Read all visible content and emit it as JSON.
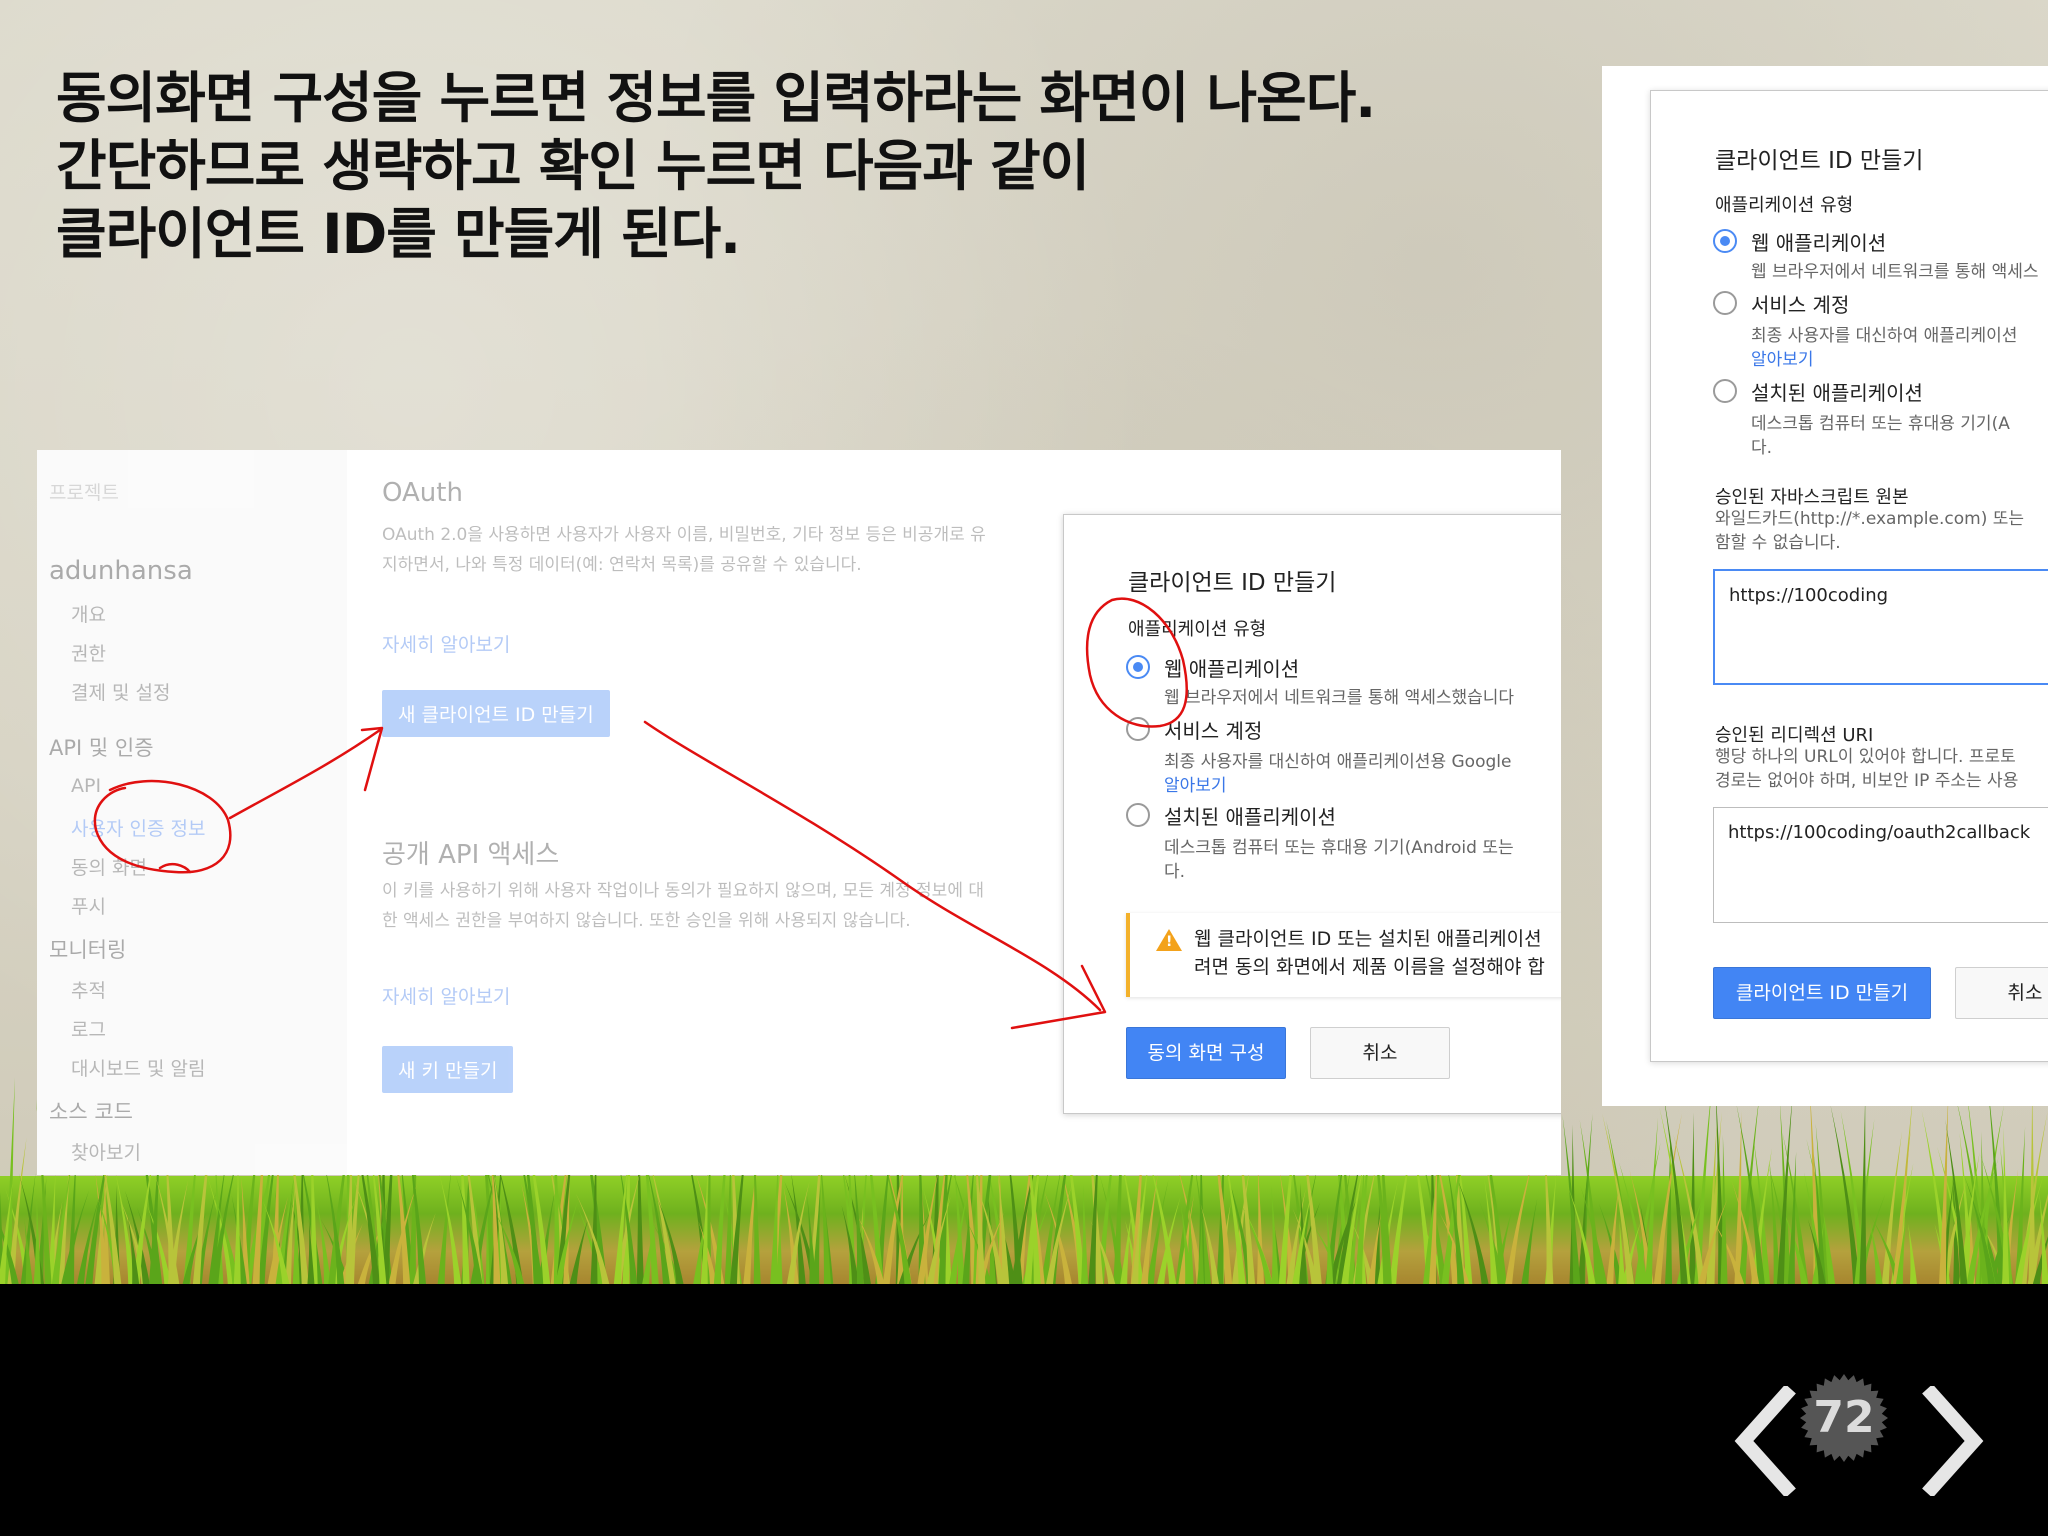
{
  "slide": {
    "title_lines": [
      "동의화면 구성을 누르면 정보를 입력하라는 화면이 나온다.",
      "간단하므로 생략하고 확인 누르면 다음과 같이",
      "클라이언트 ID를 만들게 된다."
    ],
    "page_number": "72"
  },
  "console": {
    "sidebar": {
      "project_label": "프로젝트",
      "project_name": "adunhansa",
      "items_top": [
        "개요",
        "권한",
        "결제 및 설정"
      ],
      "section_api": "API 및 인증",
      "items_api": [
        "API",
        "사용자 인증 정보",
        "동의 화면",
        "푸시"
      ],
      "section_monitoring": "모니터링",
      "items_monitoring": [
        "추적",
        "로그",
        "대시보드 및 알림"
      ],
      "section_source": "소스 코드",
      "items_source": [
        "찾아보기"
      ]
    },
    "oauth": {
      "heading": "OAuth",
      "desc": "OAuth 2.0을 사용하면 사용자가 사용자 이름, 비밀번호, 기타 정보 등은 비공개로 유지하면서, 나와 특정 데이터(예: 연락처 목록)를 공유할 수 있습니다.",
      "learn_more": "자세히 알아보기",
      "new_client_button": "새 클라이언트 ID 만들기"
    },
    "public_api": {
      "heading": "공개 API 액세스",
      "desc": "이 키를 사용하기 위해 사용자 작업이나 동의가 필요하지 않으며, 모든 계정 정보에 대한 액세스 권한을 부여하지 않습니다. 또한 승인을 위해 사용되지 않습니다.",
      "learn_more": "자세히 알아보기",
      "new_key_button": "새 키 만들기"
    },
    "dialog": {
      "title": "클라이언트 ID 만들기",
      "app_type_label": "애플리케이션 유형",
      "options": [
        {
          "label": "웹 애플리케이션",
          "desc": "웹 브라우저에서 네트워크를 통해 액세스했습니다",
          "selected": true
        },
        {
          "label": "서비스 계정",
          "desc": "최종 사용자를 대신하여 애플리케이션용 Google",
          "link": "알아보기",
          "selected": false
        },
        {
          "label": "설치된 애플리케이션",
          "desc": "데스크톱 컴퓨터 또는 휴대용 기기(Android 또는",
          "desc2": "다.",
          "selected": false
        }
      ],
      "warning_line1": "웹 클라이언트 ID 또는 설치된 애플리케이션",
      "warning_line2": "려면 동의 화면에서 제품 이름을 설정해야 합",
      "primary_button": "동의 화면 구성",
      "cancel_button": "취소"
    }
  },
  "right_dialog": {
    "title": "클라이언트 ID 만들기",
    "app_type_label": "애플리케이션 유형",
    "options": [
      {
        "label": "웹 애플리케이션",
        "desc": "웹 브라우저에서 네트워크를 통해 액세스",
        "selected": true
      },
      {
        "label": "서비스 계정",
        "desc": "최종 사용자를 대신하여 애플리케이션",
        "link": "알아보기",
        "selected": false
      },
      {
        "label": "설치된 애플리케이션",
        "desc": "데스크톱 컴퓨터 또는 휴대용 기기(A",
        "desc2": "다.",
        "selected": false
      }
    ],
    "js_origins_label": "승인된 자바스크립트 원본",
    "js_origins_hint1": "와일드카드(http://*.example.com) 또는",
    "js_origins_hint2": "함할 수 없습니다.",
    "js_origins_value": "https://100coding",
    "redirect_label": "승인된 리디렉션 URI",
    "redirect_hint1": "행당 하나의 URL이 있어야 합니다. 프로토",
    "redirect_hint2": "경로는 없어야 하며, 비보안 IP 주소는 사용",
    "redirect_value": "https://100coding/oauth2callback",
    "create_button": "클라이언트 ID 만들기",
    "cancel_button": "취소"
  },
  "colors": {
    "accent_blue": "#4285f4",
    "annotation_red": "#e01010",
    "warning_yellow": "#f3b12b",
    "bottom_bar": "#000000"
  },
  "icons": {
    "prev": "chevron-left-icon",
    "next": "chevron-right-icon",
    "warning": "warning-triangle-icon"
  }
}
